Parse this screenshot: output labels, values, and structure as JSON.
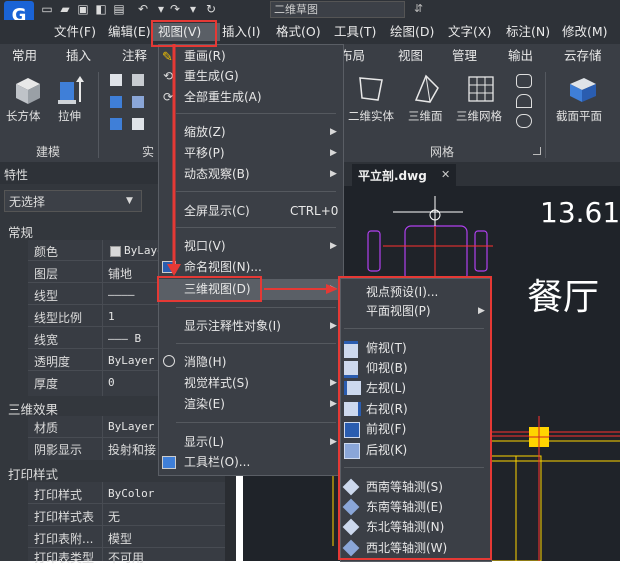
{
  "colors": {
    "accent": "#e53935",
    "brand": "#1a63d6",
    "cad_yellow": "#ffd400",
    "cad_magenta": "#c040ff"
  },
  "app": {
    "logo_letter": "G",
    "combo_value": "二维草图"
  },
  "menubar": [
    "文件(F)",
    "编辑(E)",
    "视图(V)",
    "插入(I)",
    "格式(O)",
    "工具(T)",
    "绘图(D)",
    "文字(X)",
    "标注(N)",
    "修改(M)"
  ],
  "tabs": [
    "常用",
    "插入",
    "注释",
    "布局",
    "视图",
    "管理",
    "输出",
    "云存储"
  ],
  "ribbon": {
    "box_label": "长方体",
    "extrude_label": "拉伸",
    "modeling_section": "建模",
    "solid_section_short": "实",
    "solid2d_label": "二维实体",
    "face3d_label": "三维面",
    "mesh3d_label": "三维网格",
    "grid_section": "网格",
    "section_plane_label": "截面平面"
  },
  "properties": {
    "title": "特性",
    "selection": "无选择",
    "groups": [
      {
        "name": "常规",
        "rows": [
          {
            "label": "颜色",
            "value": "ByLayer"
          },
          {
            "label": "图层",
            "value": "铺地"
          },
          {
            "label": "线型",
            "value": "————"
          },
          {
            "label": "线型比例",
            "value": "1"
          },
          {
            "label": "线宽",
            "value": "——— B"
          },
          {
            "label": "透明度",
            "value": "ByLayer"
          },
          {
            "label": "厚度",
            "value": "0"
          }
        ]
      },
      {
        "name": "三维效果",
        "rows": [
          {
            "label": "材质",
            "value": "ByLayer"
          },
          {
            "label": "阴影显示",
            "value": "投射和接"
          }
        ]
      },
      {
        "name": "打印样式",
        "rows": [
          {
            "label": "打印样式",
            "value": "ByColor"
          },
          {
            "label": "打印样式表",
            "value": "无"
          },
          {
            "label": "打印表附...",
            "value": "模型"
          },
          {
            "label": "打印表类型",
            "value": "不可用"
          }
        ]
      }
    ]
  },
  "document": {
    "tab_name": "平立剖.dwg",
    "dimension_text": "13.61",
    "room_label": "餐厅"
  },
  "view_menu": {
    "items": [
      "重画(R)",
      "重生成(G)",
      "全部重生成(A)",
      "缩放(Z)",
      "平移(P)",
      "动态观察(B)",
      "全屏显示(C)",
      "视口(V)",
      "命名视图(N)...",
      "三维视图(D)",
      "显示注释性对象(I)",
      "消隐(H)",
      "视觉样式(S)",
      "渲染(E)",
      "显示(L)",
      "工具栏(O)..."
    ],
    "fullscreen_shortcut": "CTRL+0"
  },
  "submenu_3d": {
    "items": [
      "视点预设(I)...",
      "平面视图(P)",
      "俯视(T)",
      "仰视(B)",
      "左视(L)",
      "右视(R)",
      "前视(F)",
      "后视(K)",
      "西南等轴测(S)",
      "东南等轴测(E)",
      "东北等轴测(N)",
      "西北等轴测(W)"
    ]
  }
}
